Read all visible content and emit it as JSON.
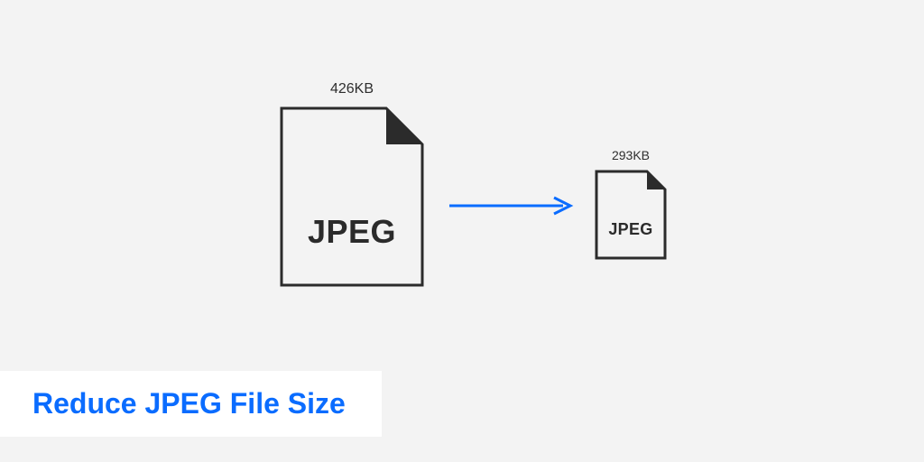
{
  "diagram": {
    "original": {
      "size_label": "426KB",
      "format_label": "JPEG"
    },
    "reduced": {
      "size_label": "293KB",
      "format_label": "JPEG"
    }
  },
  "title": "Reduce JPEG File Size",
  "colors": {
    "accent": "#0a6cff",
    "stroke": "#2b2b2b",
    "bg": "#f3f3f3"
  }
}
